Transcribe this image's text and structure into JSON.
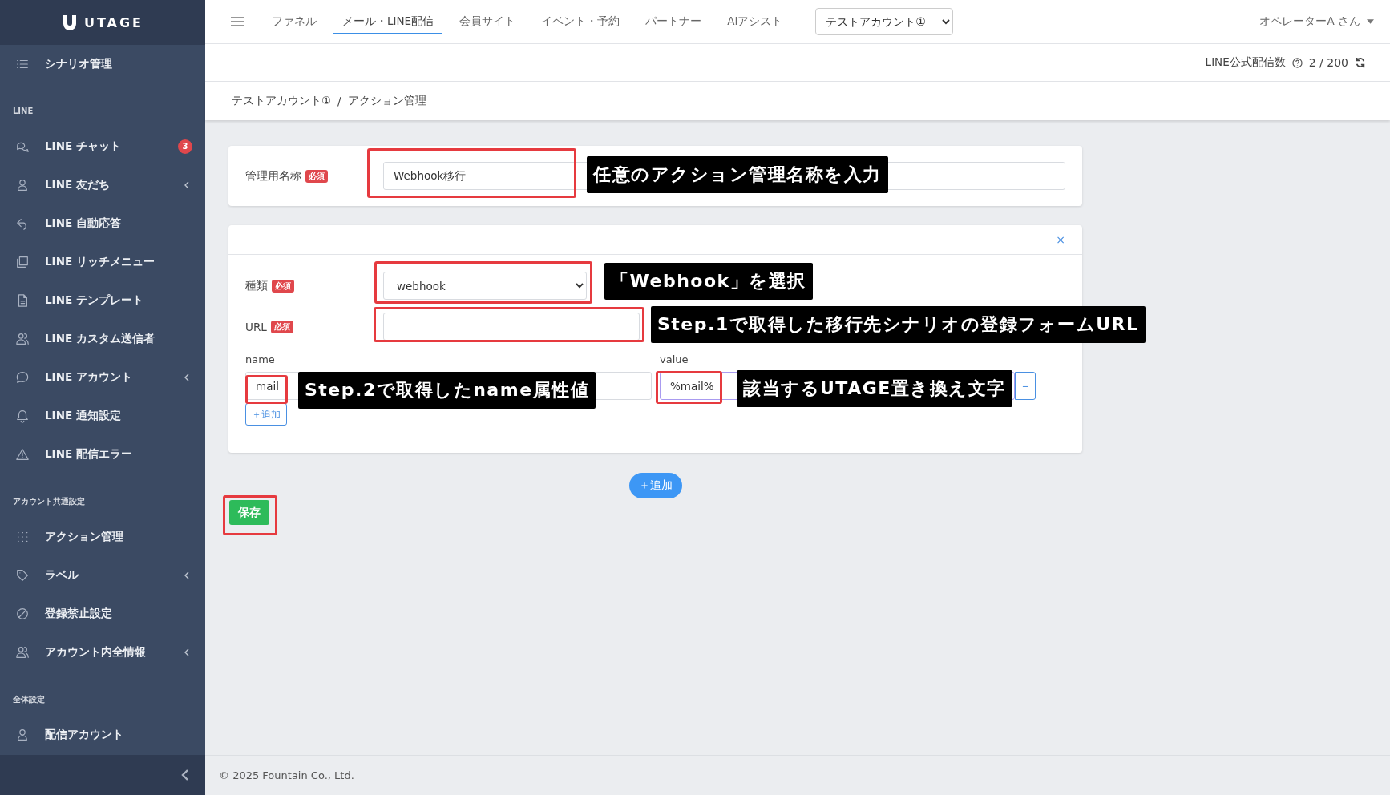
{
  "sidebar": {
    "logo": "UTAGE",
    "groups": [
      {
        "items": [
          {
            "label": "シナリオ管理",
            "submenu": false
          }
        ]
      },
      {
        "heading": "LINE",
        "items": [
          {
            "label": "LINE チャット",
            "submenu": false,
            "badge": "3"
          },
          {
            "label": "LINE 友だち",
            "submenu": true
          },
          {
            "label": "LINE 自動応答",
            "submenu": false
          },
          {
            "label": "LINE リッチメニュー",
            "submenu": false
          },
          {
            "label": "LINE テンプレート",
            "submenu": false
          },
          {
            "label": "LINE カスタム送信者",
            "submenu": false
          },
          {
            "label": "LINE アカウント",
            "submenu": true
          },
          {
            "label": "LINE 通知設定",
            "submenu": false
          },
          {
            "label": "LINE 配信エラー",
            "submenu": false
          }
        ]
      },
      {
        "heading": "アカウント共通設定",
        "items": [
          {
            "label": "アクション管理",
            "submenu": false
          },
          {
            "label": "ラベル",
            "submenu": true
          },
          {
            "label": "登録禁止設定",
            "submenu": false
          },
          {
            "label": "アカウント内全情報",
            "submenu": true
          }
        ]
      },
      {
        "heading": "全体設定",
        "items": [
          {
            "label": "配信アカウント",
            "submenu": false
          }
        ]
      }
    ]
  },
  "top_nav": {
    "tabs": [
      {
        "label": "ファネル",
        "selected": false
      },
      {
        "label": "メール・LINE配信",
        "selected": true
      },
      {
        "label": "会員サイト",
        "selected": false
      },
      {
        "label": "イベント・予約",
        "selected": false
      },
      {
        "label": "パートナー",
        "selected": false
      },
      {
        "label": "AIアシスト",
        "selected": false
      }
    ],
    "account_select": "テストアカウント①",
    "user": "オペレーターA さん"
  },
  "delivery_count": {
    "label": "LINE公式配信数",
    "count": "2 / 200"
  },
  "breadcrumb": {
    "items": [
      "テストアカウント①",
      "アクション管理"
    ],
    "separator": "/"
  },
  "name_card": {
    "label": "管理用名称",
    "badge": "必須",
    "value": "Webhook移行"
  },
  "action_card": {
    "close": "×",
    "fields": [
      {
        "kind": "select",
        "label": "種類",
        "badge": "必須",
        "value": "webhook"
      },
      {
        "kind": "input",
        "label": "URL",
        "badge": "必須"
      }
    ],
    "params": {
      "name_label": "name",
      "value_label": "value",
      "rows": [
        {
          "name": "mail",
          "value": "%mail%",
          "remove": "−"
        }
      ],
      "add": "＋追加"
    }
  },
  "add_action": "＋追加",
  "save": "保存",
  "footer": "© 2025 Fountain Co., Ltd.",
  "annotations": [
    {
      "text": "任意のアクション管理名称を入力"
    },
    {
      "text": "「Webhook」を選択"
    },
    {
      "text": "Step.1で取得した移行先シナリオの登録フォームURL"
    },
    {
      "text": "Step.2で取得したname属性値"
    },
    {
      "text": "該当するUTAGE置き換え文字"
    }
  ]
}
